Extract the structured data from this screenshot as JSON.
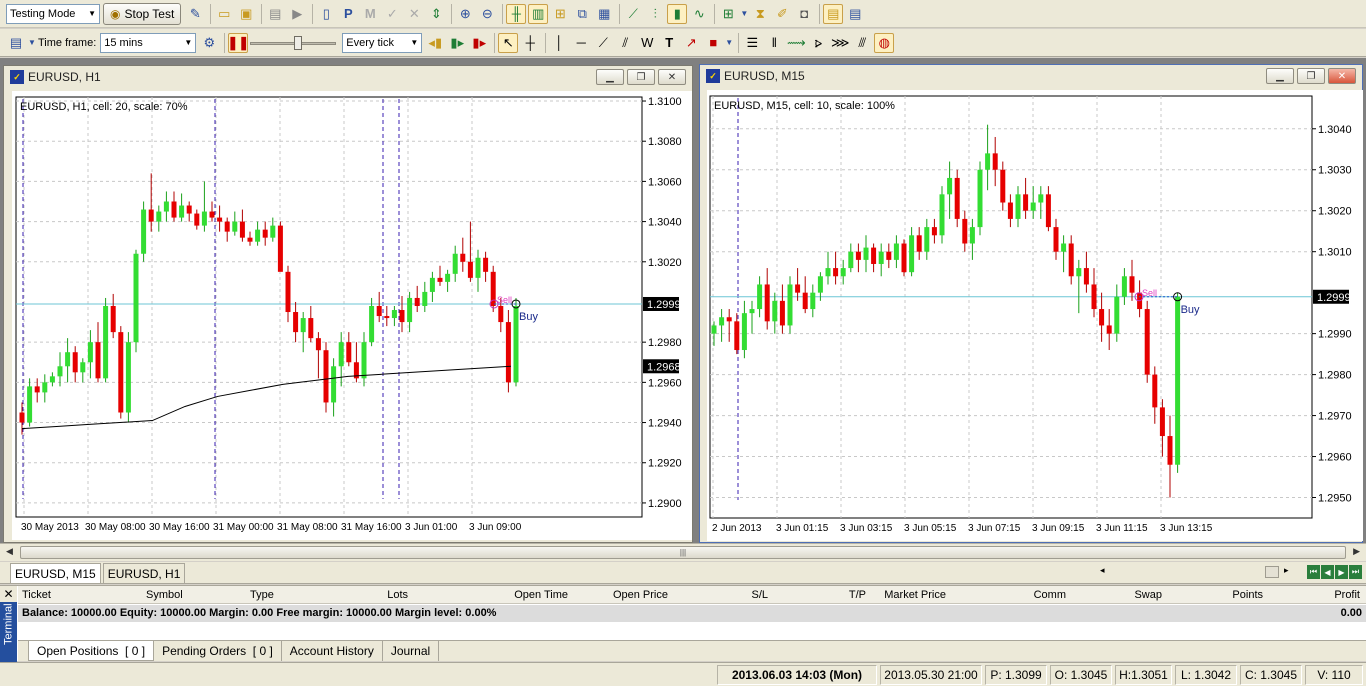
{
  "toolbar": {
    "mode_select": "Testing Mode",
    "stop_test": "Stop Test",
    "timeframe_label": "Time frame:",
    "timeframe_select": "15 mins",
    "model_select": "Every tick"
  },
  "charts": [
    {
      "window_title": "EURUSD, H1",
      "info": "EURUSD, H1, cell: 20, scale: 70%",
      "y_ticks": [
        "1.3100",
        "1.3080",
        "1.3060",
        "1.3040",
        "1.3020",
        "1.2980",
        "1.2960",
        "1.2940",
        "1.2920",
        "1.2900"
      ],
      "x_ticks": [
        "30 May 2013",
        "30 May 08:00",
        "30 May 16:00",
        "31 May 00:00",
        "31 May 08:00",
        "31 May 16:00",
        "3 Jun 01:00",
        "3 Jun 09:00"
      ],
      "price_label": "1.2999",
      "ma_label": "1.2968",
      "sell_label": "Sell",
      "buy_label": "Buy"
    },
    {
      "window_title": "EURUSD, M15",
      "info": "EURUSD, M15, cell: 10, scale: 100%",
      "y_ticks": [
        "1.3040",
        "1.3030",
        "1.3020",
        "1.3010",
        "1.2990",
        "1.2980",
        "1.2970",
        "1.2960",
        "1.2950"
      ],
      "x_ticks": [
        "2 Jun 2013",
        "3 Jun 01:15",
        "3 Jun 03:15",
        "3 Jun 05:15",
        "3 Jun 07:15",
        "3 Jun 09:15",
        "3 Jun 11:15",
        "3 Jun 13:15"
      ],
      "price_label": "1.2999",
      "sell_label": "Sell",
      "buy_label": "Buy"
    }
  ],
  "chart_tabs": [
    "EURUSD, M15",
    "EURUSD, H1"
  ],
  "terminal": {
    "side_label": "Terminal",
    "columns": [
      "Ticket",
      "Symbol",
      "Type",
      "Lots",
      "Open Time",
      "Open Price",
      "S/L",
      "T/P",
      "Market Price",
      "Comm",
      "Swap",
      "Points",
      "Profit"
    ],
    "balance_row": "Balance: 10000.00 Equity: 10000.00 Margin: 0.00 Free margin: 10000.00 Margin level: 0.00%",
    "balance_profit": "0.00",
    "tabs": [
      "Open Positions  [ 0 ]",
      "Pending Orders  [ 0 ]",
      "Account History",
      "Journal"
    ]
  },
  "status": {
    "datetime": "2013.06.03 14:03 (Mon)",
    "bar_time": "2013.05.30 21:00",
    "p": "P: 1.3099",
    "o": "O: 1.3045",
    "h": "H:1.3051",
    "l": "L: 1.3042",
    "c": "C: 1.3045",
    "v": "V: 110"
  },
  "colors": {
    "bull": "#33dd33",
    "bear": "#e60000",
    "grid": "#c8c8c8",
    "price_line": "#6cc6d6",
    "ma": "#000000",
    "vline": "#3a1fb0"
  },
  "chart_data": [
    {
      "type": "candlestick",
      "title": "EURUSD, H1",
      "ylim": [
        1.2893,
        1.3102
      ],
      "candles": [
        [
          1.2945,
          1.295,
          1.2934,
          1.294
        ],
        [
          1.294,
          1.2962,
          1.2938,
          1.2958
        ],
        [
          1.2958,
          1.2962,
          1.295,
          1.2955
        ],
        [
          1.2955,
          1.2964,
          1.295,
          1.296
        ],
        [
          1.296,
          1.2965,
          1.2958,
          1.2963
        ],
        [
          1.2963,
          1.2975,
          1.2958,
          1.2968
        ],
        [
          1.2968,
          1.2982,
          1.296,
          1.2975
        ],
        [
          1.2975,
          1.2978,
          1.296,
          1.2965
        ],
        [
          1.2965,
          1.2972,
          1.296,
          1.297
        ],
        [
          1.297,
          1.2986,
          1.2962,
          1.298
        ],
        [
          1.298,
          1.299,
          1.296,
          1.2962
        ],
        [
          1.2962,
          1.3002,
          1.296,
          1.2998
        ],
        [
          1.2998,
          1.3004,
          1.2982,
          1.2985
        ],
        [
          1.2985,
          1.2988,
          1.2942,
          1.2945
        ],
        [
          1.2945,
          1.2985,
          1.294,
          1.298
        ],
        [
          1.298,
          1.3026,
          1.2975,
          1.3024
        ],
        [
          1.3024,
          1.305,
          1.302,
          1.3046
        ],
        [
          1.3046,
          1.3064,
          1.3035,
          1.304
        ],
        [
          1.304,
          1.3048,
          1.3035,
          1.3045
        ],
        [
          1.3045,
          1.3055,
          1.304,
          1.305
        ],
        [
          1.305,
          1.3055,
          1.304,
          1.3042
        ],
        [
          1.3042,
          1.3054,
          1.304,
          1.3048
        ],
        [
          1.3048,
          1.305,
          1.304,
          1.3044
        ],
        [
          1.3044,
          1.3046,
          1.3036,
          1.3038
        ],
        [
          1.3038,
          1.306,
          1.3035,
          1.3045
        ],
        [
          1.3045,
          1.305,
          1.304,
          1.3042
        ],
        [
          1.3042,
          1.3048,
          1.3035,
          1.304
        ],
        [
          1.304,
          1.3042,
          1.303,
          1.3035
        ],
        [
          1.3035,
          1.3045,
          1.3033,
          1.304
        ],
        [
          1.304,
          1.3046,
          1.303,
          1.3032
        ],
        [
          1.3032,
          1.3035,
          1.3028,
          1.303
        ],
        [
          1.303,
          1.304,
          1.3028,
          1.3036
        ],
        [
          1.3036,
          1.304,
          1.3028,
          1.3032
        ],
        [
          1.3032,
          1.3042,
          1.303,
          1.3038
        ],
        [
          1.3038,
          1.304,
          1.302,
          1.3015
        ],
        [
          1.3015,
          1.3018,
          1.299,
          1.2995
        ],
        [
          1.2995,
          1.3,
          1.298,
          1.2985
        ],
        [
          1.2985,
          1.2995,
          1.2975,
          1.2992
        ],
        [
          1.2992,
          1.2998,
          1.298,
          1.2982
        ],
        [
          1.2982,
          1.2985,
          1.2962,
          1.2976
        ],
        [
          1.2976,
          1.298,
          1.2945,
          1.295
        ],
        [
          1.295,
          1.2972,
          1.2943,
          1.2968
        ],
        [
          1.2968,
          1.2985,
          1.2958,
          1.298
        ],
        [
          1.298,
          1.2985,
          1.2968,
          1.297
        ],
        [
          1.297,
          1.298,
          1.296,
          1.2962
        ],
        [
          1.2962,
          1.2985,
          1.2958,
          1.298
        ],
        [
          1.298,
          1.3002,
          1.2978,
          1.2998
        ],
        [
          1.2998,
          1.3005,
          1.299,
          1.2993
        ],
        [
          1.2993,
          1.2998,
          1.2988,
          1.2992
        ],
        [
          1.2992,
          1.2998,
          1.2988,
          1.2996
        ],
        [
          1.2996,
          1.3003,
          1.2985,
          1.299
        ],
        [
          1.299,
          1.3005,
          1.2985,
          1.3002
        ],
        [
          1.3002,
          1.3008,
          1.2995,
          1.2998
        ],
        [
          1.2998,
          1.301,
          1.2995,
          1.3005
        ],
        [
          1.3005,
          1.3015,
          1.3,
          1.3012
        ],
        [
          1.3012,
          1.3018,
          1.3008,
          1.301
        ],
        [
          1.301,
          1.3016,
          1.3005,
          1.3014
        ],
        [
          1.3014,
          1.3028,
          1.301,
          1.3024
        ],
        [
          1.3024,
          1.3032,
          1.3015,
          1.302
        ],
        [
          1.302,
          1.304,
          1.301,
          1.3012
        ],
        [
          1.3012,
          1.3026,
          1.3005,
          1.3022
        ],
        [
          1.3022,
          1.3025,
          1.301,
          1.3015
        ],
        [
          1.3015,
          1.3018,
          1.2995,
          1.2998
        ],
        [
          1.2998,
          1.3002,
          1.2985,
          1.299
        ],
        [
          1.299,
          1.2996,
          1.2955,
          1.296
        ],
        [
          1.296,
          1.3002,
          1.2958,
          1.2998
        ]
      ],
      "ma": [
        1.2937,
        1.2938,
        1.2939,
        1.294,
        1.2941,
        1.2948,
        1.2953,
        1.2956,
        1.2959,
        1.2961,
        1.2963,
        1.2964,
        1.2965,
        1.2966,
        1.2967,
        1.2968
      ],
      "price_line": 1.2999
    },
    {
      "type": "candlestick",
      "title": "EURUSD, M15",
      "ylim": [
        1.2945,
        1.3048
      ],
      "candles": [
        [
          1.299,
          1.2993,
          1.2987,
          1.2992
        ],
        [
          1.2992,
          1.2996,
          1.2988,
          1.2994
        ],
        [
          1.2994,
          1.2996,
          1.2988,
          1.2993
        ],
        [
          1.2993,
          1.2995,
          1.2985,
          1.2986
        ],
        [
          1.2986,
          1.2998,
          1.2984,
          1.2995
        ],
        [
          1.2995,
          1.2998,
          1.299,
          1.2996
        ],
        [
          1.2996,
          1.3004,
          1.2994,
          1.3002
        ],
        [
          1.3002,
          1.3006,
          1.2991,
          1.2993
        ],
        [
          1.2993,
          1.3,
          1.299,
          1.2998
        ],
        [
          1.2998,
          1.3002,
          1.299,
          1.2992
        ],
        [
          1.2992,
          1.3004,
          1.299,
          1.3002
        ],
        [
          1.3002,
          1.3006,
          1.2998,
          1.3
        ],
        [
          1.3,
          1.3004,
          1.2995,
          1.2996
        ],
        [
          1.2996,
          1.3002,
          1.2994,
          1.3
        ],
        [
          1.3,
          1.3005,
          1.2998,
          1.3004
        ],
        [
          1.3004,
          1.301,
          1.3002,
          1.3006
        ],
        [
          1.3006,
          1.301,
          1.3002,
          1.3004
        ],
        [
          1.3004,
          1.3008,
          1.3002,
          1.3006
        ],
        [
          1.3006,
          1.3012,
          1.3005,
          1.301
        ],
        [
          1.301,
          1.3012,
          1.3005,
          1.3008
        ],
        [
          1.3008,
          1.3014,
          1.3005,
          1.3011
        ],
        [
          1.3011,
          1.3012,
          1.3005,
          1.3007
        ],
        [
          1.3007,
          1.3012,
          1.3004,
          1.301
        ],
        [
          1.301,
          1.3012,
          1.3006,
          1.3008
        ],
        [
          1.3008,
          1.3014,
          1.3006,
          1.3012
        ],
        [
          1.3012,
          1.3013,
          1.3004,
          1.3005
        ],
        [
          1.3005,
          1.3016,
          1.3004,
          1.3014
        ],
        [
          1.3014,
          1.3016,
          1.3008,
          1.301
        ],
        [
          1.301,
          1.3018,
          1.3008,
          1.3016
        ],
        [
          1.3016,
          1.3018,
          1.3012,
          1.3014
        ],
        [
          1.3014,
          1.3026,
          1.3012,
          1.3024
        ],
        [
          1.3024,
          1.3032,
          1.3018,
          1.3028
        ],
        [
          1.3028,
          1.303,
          1.3016,
          1.3018
        ],
        [
          1.3018,
          1.302,
          1.301,
          1.3012
        ],
        [
          1.3012,
          1.3018,
          1.3008,
          1.3016
        ],
        [
          1.3016,
          1.3032,
          1.3014,
          1.303
        ],
        [
          1.303,
          1.3041,
          1.3025,
          1.3034
        ],
        [
          1.3034,
          1.3038,
          1.3026,
          1.303
        ],
        [
          1.303,
          1.3032,
          1.302,
          1.3022
        ],
        [
          1.3022,
          1.3024,
          1.3016,
          1.3018
        ],
        [
          1.3018,
          1.3026,
          1.3016,
          1.3024
        ],
        [
          1.3024,
          1.3028,
          1.3018,
          1.302
        ],
        [
          1.302,
          1.3026,
          1.3018,
          1.3022
        ],
        [
          1.3022,
          1.3026,
          1.3018,
          1.3024
        ],
        [
          1.3024,
          1.3026,
          1.3015,
          1.3016
        ],
        [
          1.3016,
          1.3018,
          1.3008,
          1.301
        ],
        [
          1.301,
          1.3014,
          1.3005,
          1.3012
        ],
        [
          1.3012,
          1.3014,
          1.3002,
          1.3004
        ],
        [
          1.3004,
          1.3008,
          1.2995,
          1.3006
        ],
        [
          1.3006,
          1.301,
          1.3,
          1.3002
        ],
        [
          1.3002,
          1.3006,
          1.2994,
          1.2996
        ],
        [
          1.2996,
          1.3,
          1.2988,
          1.2992
        ],
        [
          1.2992,
          1.2996,
          1.2986,
          1.299
        ],
        [
          1.299,
          1.3002,
          1.2988,
          1.2999
        ],
        [
          1.2999,
          1.3006,
          1.2997,
          1.3004
        ],
        [
          1.3004,
          1.3008,
          1.2998,
          1.3
        ],
        [
          1.3,
          1.3003,
          1.2994,
          1.2996
        ],
        [
          1.2996,
          1.2998,
          1.2978,
          1.298
        ],
        [
          1.298,
          1.2982,
          1.2968,
          1.2972
        ],
        [
          1.2972,
          1.2974,
          1.296,
          1.2965
        ],
        [
          1.2965,
          1.297,
          1.295,
          1.2958
        ],
        [
          1.2958,
          1.3,
          1.2956,
          1.2999
        ]
      ],
      "price_line": 1.2999
    }
  ]
}
